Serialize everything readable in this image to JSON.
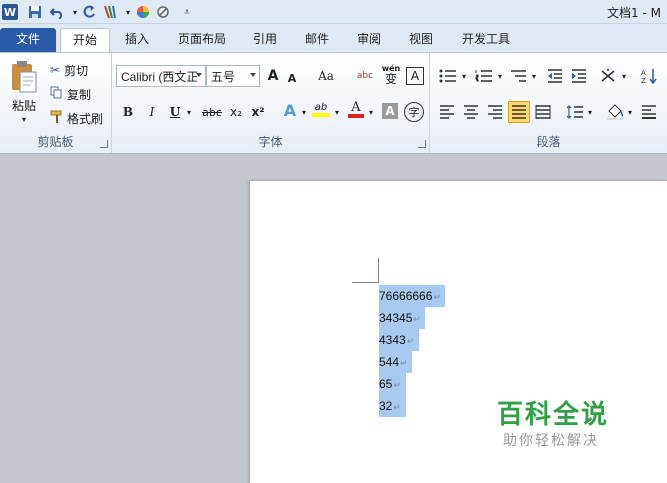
{
  "window": {
    "title": "文档1 - M"
  },
  "qat": {
    "word_logo": "W"
  },
  "tabs": [
    {
      "label": "文件"
    },
    {
      "label": "开始"
    },
    {
      "label": "插入"
    },
    {
      "label": "页面布局"
    },
    {
      "label": "引用"
    },
    {
      "label": "邮件"
    },
    {
      "label": "审阅"
    },
    {
      "label": "视图"
    },
    {
      "label": "开发工具"
    }
  ],
  "clipboard": {
    "label": "剪贴板",
    "paste": "粘贴",
    "cut": "剪切",
    "copy": "复制",
    "format_painter": "格式刷"
  },
  "font": {
    "label": "字体",
    "font_name": "Calibri (西文正",
    "font_size": "五号",
    "grow": "A",
    "shrink": "A",
    "change_case": "Aa",
    "phonetic": "wén",
    "phonetic_base": "变",
    "border_char": "A",
    "bold": "B",
    "italic": "I",
    "underline": "U",
    "strike": "abc",
    "subscript": "x₂",
    "superscript": "x²",
    "text_effect": "A",
    "highlight": "ab",
    "font_color": "A",
    "shading": "A",
    "enclose": "字"
  },
  "paragraph": {
    "label": "段落"
  },
  "document": {
    "lines": [
      "76666666",
      "34345",
      "4343",
      "544",
      "65",
      "32"
    ],
    "paragraph_mark": "↵"
  },
  "watermark": {
    "title": "百科全说",
    "subtitle": "助你轻松解决"
  },
  "colors": {
    "file_tab": "#2a5ba8",
    "selection": "#a8c9f0",
    "watermark_green": "#2fa145"
  }
}
